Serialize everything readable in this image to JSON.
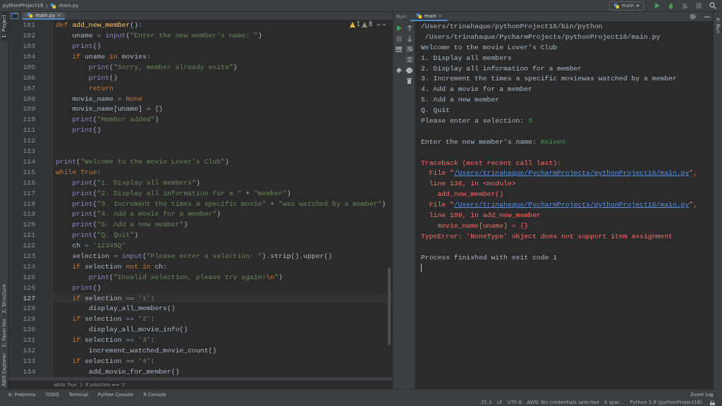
{
  "breadcrumb": [
    "pythonProject16",
    "main.py"
  ],
  "toolbar": {
    "run_config": "main"
  },
  "left_strip": [
    {
      "label": "1: Project",
      "selected": true
    },
    {
      "label": "2: Structure",
      "selected": false
    },
    {
      "label": "2: Favorites",
      "selected": false
    },
    {
      "label": "AWS Explorer",
      "selected": false
    }
  ],
  "right_strip": [
    "4: Run"
  ],
  "editor_tabs": [
    {
      "label": "main.py",
      "selected": true
    }
  ],
  "inspections": {
    "warnings": "1",
    "weak_warnings": "8"
  },
  "code_lines": [
    {
      "number": "101",
      "current": false,
      "segments": [
        {
          "kind": "kw",
          "text": "def "
        },
        {
          "kind": "fn",
          "text": "add_new_member"
        },
        {
          "kind": "plain",
          "text": "():"
        }
      ]
    },
    {
      "number": "102",
      "current": false,
      "segments": [
        {
          "kind": "plain",
          "text": "    uname = "
        },
        {
          "kind": "builtin",
          "text": "input"
        },
        {
          "kind": "plain",
          "text": "("
        },
        {
          "kind": "str",
          "text": "\"Enter the new member's name: \""
        },
        {
          "kind": "plain",
          "text": ")"
        }
      ]
    },
    {
      "number": "103",
      "current": false,
      "segments": [
        {
          "kind": "builtin",
          "text": "    print"
        },
        {
          "kind": "plain",
          "text": "()"
        }
      ]
    },
    {
      "number": "104",
      "current": false,
      "segments": [
        {
          "kind": "kw",
          "text": "    if"
        },
        {
          "kind": "plain",
          "text": " uname "
        },
        {
          "kind": "kw",
          "text": "in"
        },
        {
          "kind": "plain",
          "text": " movies:"
        }
      ]
    },
    {
      "number": "105",
      "current": false,
      "segments": [
        {
          "kind": "builtin",
          "text": "        print"
        },
        {
          "kind": "plain",
          "text": "("
        },
        {
          "kind": "str",
          "text": "\"Sorry, member already exits\""
        },
        {
          "kind": "plain",
          "text": ")"
        }
      ]
    },
    {
      "number": "106",
      "current": false,
      "segments": [
        {
          "kind": "builtin",
          "text": "        print"
        },
        {
          "kind": "plain",
          "text": "()"
        }
      ]
    },
    {
      "number": "107",
      "current": false,
      "segments": [
        {
          "kind": "kw",
          "text": "        return"
        }
      ]
    },
    {
      "number": "108",
      "current": false,
      "segments": [
        {
          "kind": "plain",
          "text": "    movie_name = "
        },
        {
          "kind": "kw",
          "text": "None"
        }
      ]
    },
    {
      "number": "109",
      "current": false,
      "segments": [
        {
          "kind": "plain",
          "text": "    movie_name[uname] = {}"
        }
      ]
    },
    {
      "number": "110",
      "current": false,
      "segments": [
        {
          "kind": "builtin",
          "text": "    print"
        },
        {
          "kind": "plain",
          "text": "("
        },
        {
          "kind": "str",
          "text": "\"Member added\""
        },
        {
          "kind": "plain",
          "text": ")"
        }
      ]
    },
    {
      "number": "111",
      "current": false,
      "segments": [
        {
          "kind": "builtin",
          "text": "    print"
        },
        {
          "kind": "plain",
          "text": "()"
        }
      ]
    },
    {
      "number": "112",
      "current": false
    },
    {
      "number": "113",
      "current": false
    },
    {
      "number": "114",
      "current": false,
      "segments": [
        {
          "kind": "builtin",
          "text": "print"
        },
        {
          "kind": "plain",
          "text": "("
        },
        {
          "kind": "str",
          "text": "\"Welcome to the movie Lover's Club\""
        },
        {
          "kind": "plain",
          "text": ")"
        }
      ]
    },
    {
      "number": "115",
      "current": false,
      "segments": [
        {
          "kind": "kw",
          "text": "while True"
        },
        {
          "kind": "plain",
          "text": ":"
        }
      ]
    },
    {
      "number": "116",
      "current": false,
      "segments": [
        {
          "kind": "builtin",
          "text": "    print"
        },
        {
          "kind": "plain",
          "text": "("
        },
        {
          "kind": "str",
          "text": "\"1. Display all members\""
        },
        {
          "kind": "plain",
          "text": ")"
        }
      ]
    },
    {
      "number": "117",
      "current": false,
      "segments": [
        {
          "kind": "builtin",
          "text": "    print"
        },
        {
          "kind": "plain",
          "text": "("
        },
        {
          "kind": "str",
          "text": "\"2. Display all information for a \""
        },
        {
          "kind": "plain",
          "text": " + "
        },
        {
          "kind": "str",
          "text": "\"member\""
        },
        {
          "kind": "plain",
          "text": ")"
        }
      ]
    },
    {
      "number": "118",
      "current": false,
      "segments": [
        {
          "kind": "builtin",
          "text": "    print"
        },
        {
          "kind": "plain",
          "text": "("
        },
        {
          "kind": "str",
          "text": "\"3. Increment the times a specific movie\""
        },
        {
          "kind": "plain",
          "text": " + "
        },
        {
          "kind": "str",
          "text": "\"was watched by a member\""
        },
        {
          "kind": "plain",
          "text": ")"
        }
      ]
    },
    {
      "number": "119",
      "current": false,
      "segments": [
        {
          "kind": "builtin",
          "text": "    print"
        },
        {
          "kind": "plain",
          "text": "("
        },
        {
          "kind": "str",
          "text": "\"4. Add a movie for a member\""
        },
        {
          "kind": "plain",
          "text": ")"
        }
      ]
    },
    {
      "number": "120",
      "current": false,
      "segments": [
        {
          "kind": "builtin",
          "text": "    print"
        },
        {
          "kind": "plain",
          "text": "("
        },
        {
          "kind": "str",
          "text": "\"5. Add a new member\""
        },
        {
          "kind": "plain",
          "text": ")"
        }
      ]
    },
    {
      "number": "121",
      "current": false,
      "segments": [
        {
          "kind": "builtin",
          "text": "    print"
        },
        {
          "kind": "plain",
          "text": "("
        },
        {
          "kind": "str",
          "text": "\"Q. Quit\""
        },
        {
          "kind": "plain",
          "text": ")"
        }
      ]
    },
    {
      "number": "122",
      "current": false,
      "segments": [
        {
          "kind": "plain",
          "text": "    ch = "
        },
        {
          "kind": "str",
          "text": "'12345Q'"
        }
      ]
    },
    {
      "number": "123",
      "current": false,
      "segments": [
        {
          "kind": "plain",
          "text": "    selection = "
        },
        {
          "kind": "builtin",
          "text": "input"
        },
        {
          "kind": "plain",
          "text": "("
        },
        {
          "kind": "str",
          "text": "\"Please enter a selection: \""
        },
        {
          "kind": "plain",
          "text": ").strip().upper()"
        }
      ]
    },
    {
      "number": "124",
      "current": false,
      "segments": [
        {
          "kind": "kw",
          "text": "    if"
        },
        {
          "kind": "plain",
          "text": " selection "
        },
        {
          "kind": "kw",
          "text": "not in"
        },
        {
          "kind": "plain",
          "text": " ch:"
        }
      ]
    },
    {
      "number": "125",
      "current": false,
      "segments": [
        {
          "kind": "builtin",
          "text": "        print"
        },
        {
          "kind": "plain",
          "text": "("
        },
        {
          "kind": "str",
          "text": "\"Invalid selection, please try again!"
        },
        {
          "kind": "esc",
          "text": "\\n"
        },
        {
          "kind": "str",
          "text": "\""
        },
        {
          "kind": "plain",
          "text": ")"
        }
      ]
    },
    {
      "number": "126",
      "current": false,
      "segments": [
        {
          "kind": "builtin",
          "text": "    print"
        },
        {
          "kind": "plain",
          "text": "()"
        }
      ]
    },
    {
      "number": "127",
      "current": true,
      "segments": [
        {
          "kind": "kw",
          "text": "    if"
        },
        {
          "kind": "plain",
          "text": " selection == "
        },
        {
          "kind": "str",
          "text": "'1'"
        },
        {
          "kind": "plain",
          "text": ":"
        }
      ]
    },
    {
      "number": "128",
      "current": false,
      "segments": [
        {
          "kind": "plain",
          "text": "        display_all_members()"
        }
      ]
    },
    {
      "number": "129",
      "current": false,
      "segments": [
        {
          "kind": "kw",
          "text": "    if"
        },
        {
          "kind": "plain",
          "text": " selection == "
        },
        {
          "kind": "str",
          "text": "'2'"
        },
        {
          "kind": "plain",
          "text": ":"
        }
      ]
    },
    {
      "number": "130",
      "current": false,
      "segments": [
        {
          "kind": "plain",
          "text": "        display_all_movie_info()"
        }
      ]
    },
    {
      "number": "131",
      "current": false,
      "segments": [
        {
          "kind": "kw",
          "text": "    if"
        },
        {
          "kind": "plain",
          "text": " selection == "
        },
        {
          "kind": "str",
          "text": "'3'"
        },
        {
          "kind": "plain",
          "text": ":"
        }
      ]
    },
    {
      "number": "132",
      "current": false,
      "segments": [
        {
          "kind": "plain",
          "text": "        increment_watched_movie_count()"
        }
      ]
    },
    {
      "number": "133",
      "current": false,
      "segments": [
        {
          "kind": "kw",
          "text": "    if"
        },
        {
          "kind": "plain",
          "text": " selection == "
        },
        {
          "kind": "str",
          "text": "'4'"
        },
        {
          "kind": "plain",
          "text": ":"
        }
      ]
    },
    {
      "number": "134",
      "current": false,
      "segments": [
        {
          "kind": "plain",
          "text": "        add_movie_for_member()"
        }
      ]
    }
  ],
  "code_breadcrumb": [
    "while True",
    "if selection == '1'"
  ],
  "run_panel": {
    "label": "Run:",
    "tabs": [
      {
        "label": "main",
        "selected": true
      }
    ]
  },
  "console_lines": [
    {
      "segments": [
        {
          "kind": "plain",
          "text": "/Users/trinahaque/pythonProject16/bin/python"
        }
      ]
    },
    {
      "segments": [
        {
          "kind": "plain",
          "text": " /Users/trinahaque/PycharmProjects/pythonProject16/main.py"
        }
      ]
    },
    {
      "segments": [
        {
          "kind": "plain",
          "text": "Welcome to the movie Lover's Club"
        }
      ]
    },
    {
      "segments": [
        {
          "kind": "plain",
          "text": "1. Display all members"
        }
      ]
    },
    {
      "segments": [
        {
          "kind": "plain",
          "text": "2. Display all information for a member"
        }
      ]
    },
    {
      "segments": [
        {
          "kind": "plain",
          "text": "3. Increment the times a specific moviewas watched by a member"
        }
      ]
    },
    {
      "segments": [
        {
          "kind": "plain",
          "text": "4. Add a movie for a member"
        }
      ]
    },
    {
      "segments": [
        {
          "kind": "plain",
          "text": "5. Add a new member"
        }
      ]
    },
    {
      "segments": [
        {
          "kind": "plain",
          "text": "Q. Quit"
        }
      ]
    },
    {
      "segments": [
        {
          "kind": "plain",
          "text": "Please enter a selection: "
        },
        {
          "kind": "input",
          "text": "5"
        }
      ]
    },
    {
      "kind": "blank"
    },
    {
      "segments": [
        {
          "kind": "plain",
          "text": "Enter the new member's name: "
        },
        {
          "kind": "input",
          "text": "Keiven"
        }
      ]
    },
    {
      "kind": "blank"
    },
    {
      "segments": [
        {
          "kind": "error",
          "text": "Traceback (most recent call last):"
        }
      ]
    },
    {
      "segments": [
        {
          "kind": "error",
          "text": "  File \""
        },
        {
          "kind": "link",
          "text": "/Users/trinahaque/PycharmProjects/pythonProject16/main.py"
        },
        {
          "kind": "error",
          "text": "\","
        }
      ]
    },
    {
      "segments": [
        {
          "kind": "error",
          "text": "  line 136, in <module>"
        }
      ]
    },
    {
      "segments": [
        {
          "kind": "error",
          "text": "    add_new_member()"
        }
      ]
    },
    {
      "segments": [
        {
          "kind": "error",
          "text": "  File \""
        },
        {
          "kind": "link",
          "text": "/Users/trinahaque/PycharmProjects/pythonProject16/main.py"
        },
        {
          "kind": "error",
          "text": "\","
        }
      ]
    },
    {
      "segments": [
        {
          "kind": "error",
          "text": "  line 109, in add_new_member"
        }
      ]
    },
    {
      "segments": [
        {
          "kind": "error",
          "text": "    movie_name[uname] = {}"
        }
      ]
    },
    {
      "segments": [
        {
          "kind": "error",
          "text": "TypeError: 'NoneType' object does not support item assignment"
        }
      ]
    },
    {
      "kind": "blank"
    },
    {
      "segments": [
        {
          "kind": "plain",
          "text": "Process finished with exit code 1"
        }
      ]
    }
  ],
  "bottom_tabs": [
    "6: Problems",
    "TODO",
    "Terminal",
    "Python Console",
    "R Console"
  ],
  "event_log": "Event Log",
  "status_bar": [
    "21:1",
    "LF",
    "UTF-8",
    "AWS: No credentials selected",
    "4 spac...",
    "Python 3.8 (pythonProject16)"
  ]
}
